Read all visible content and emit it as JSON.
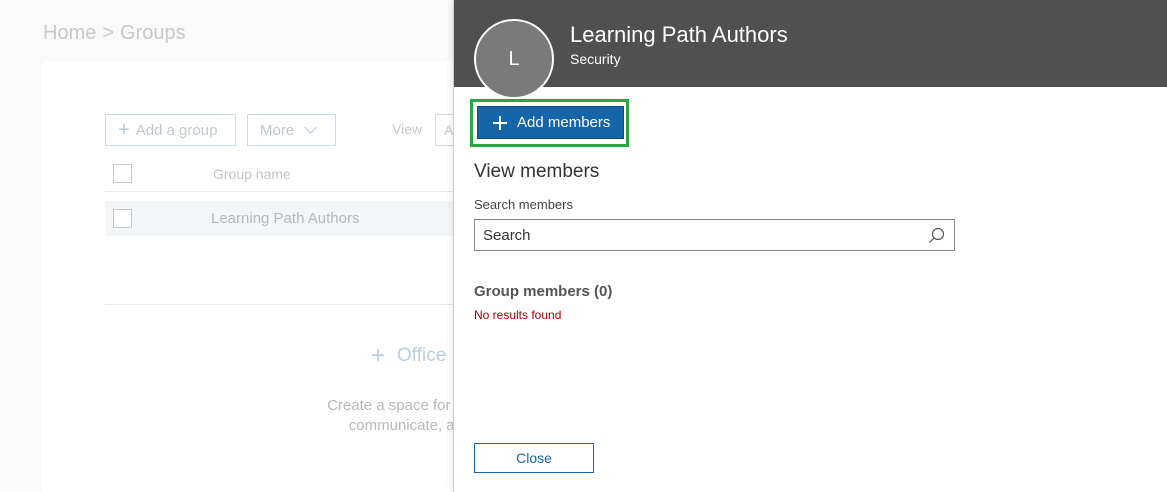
{
  "breadcrumb": {
    "home": "Home",
    "separator": ">",
    "current": "Groups"
  },
  "background": {
    "add_group_label": "Add a group",
    "more_label": "More",
    "view_label": "View",
    "view_select_partial": "A",
    "column_header": "Group name",
    "row_label": "Learning Path Authors",
    "office_label": "Office",
    "description_line1": "Create a space for a",
    "description_line2": "communicate, an"
  },
  "panel": {
    "avatar_letter": "L",
    "title": "Learning Path Authors",
    "subtitle": "Security",
    "add_members_label": "Add members",
    "view_members_title": "View members",
    "search_label": "Search members",
    "search_placeholder": "Search",
    "group_members_title": "Group members (0)",
    "no_results": "No results found",
    "close_label": "Close"
  },
  "colors": {
    "header_bg": "#505050",
    "primary": "#1565a8",
    "highlight": "#28a745",
    "error": "#a80000"
  }
}
